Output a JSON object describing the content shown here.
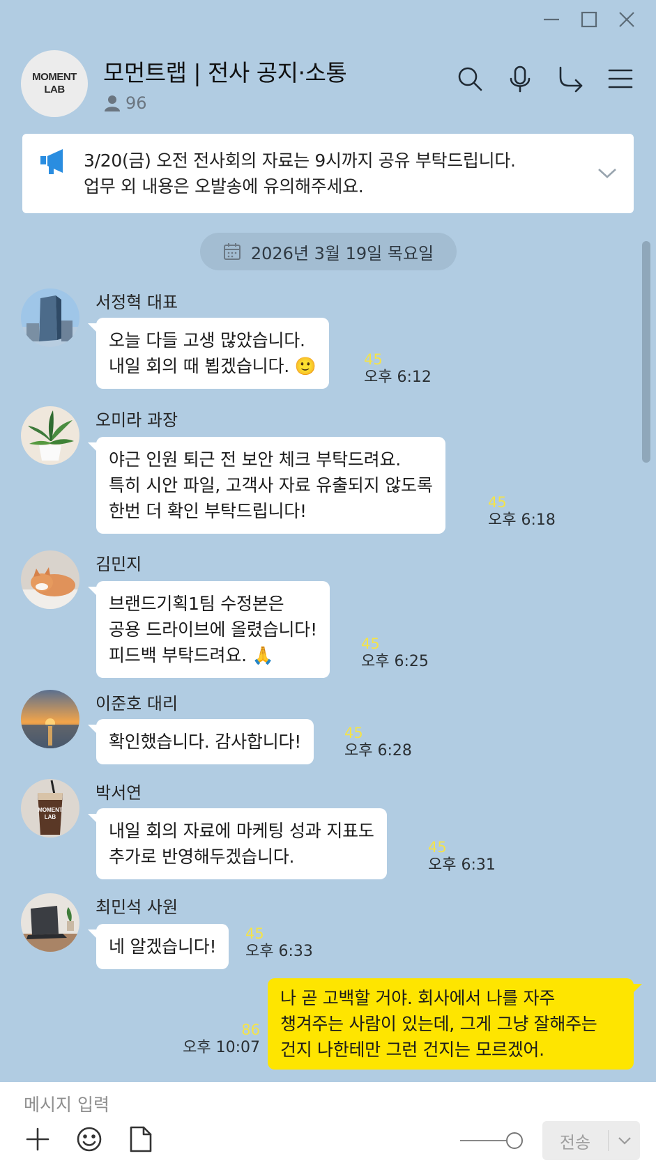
{
  "window": {
    "controls": [
      "minimize-icon",
      "maximize-icon",
      "close-icon"
    ]
  },
  "room": {
    "logo_line1": "MOMENT",
    "logo_line2": "LAB",
    "title": "모먼트랩 | 전사 공지·소통",
    "member_count": "96"
  },
  "header_actions": [
    "search-icon",
    "microphone-icon",
    "share-icon",
    "menu-icon"
  ],
  "notice": {
    "line1": "3/20(금) 오전 전사회의 자료는 9시까지 공유 부탁드립니다.",
    "line2": "업무 외 내용은 오발송에 유의해주세요."
  },
  "date_divider": "2026년 3월 19일 목요일",
  "messages": [
    {
      "sender": "서정혁 대표",
      "lines": [
        "오늘 다들 고생 많았습니다.",
        "내일 회의 때 뵙겠습니다. 🙂"
      ],
      "unread": "45",
      "time": "오후 6:12",
      "avatar": "building-avatar"
    },
    {
      "sender": "오미라 과장",
      "lines": [
        "야근 인원 퇴근 전 보안 체크 부탁드려요.",
        "특히 시안 파일, 고객사 자료 유출되지 않도록",
        "한번 더 확인 부탁드립니다!"
      ],
      "unread": "45",
      "time": "오후 6:18",
      "avatar": "plant-avatar"
    },
    {
      "sender": "김민지",
      "lines": [
        "브랜드기획1팀 수정본은",
        "공용 드라이브에 올렸습니다!",
        "피드백 부탁드려요. 🙏"
      ],
      "unread": "45",
      "time": "오후 6:25",
      "avatar": "cat-avatar"
    },
    {
      "sender": "이준호 대리",
      "lines": [
        "확인했습니다. 감사합니다!"
      ],
      "unread": "45",
      "time": "오후 6:28",
      "avatar": "sunset-avatar"
    },
    {
      "sender": "박서연",
      "lines": [
        "내일 회의 자료에 마케팅 성과 지표도",
        "추가로 반영해두겠습니다."
      ],
      "unread": "45",
      "time": "오후 6:31",
      "avatar": "coffee-avatar",
      "cup_text1": "MOMENT",
      "cup_text2": "LAB"
    },
    {
      "sender": "최민석 사원",
      "lines": [
        "네 알겠습니다!"
      ],
      "unread": "45",
      "time": "오후 6:33",
      "avatar": "laptop-avatar"
    }
  ],
  "my_message": {
    "lines": [
      "나 곧 고백할 거야. 회사에서 나를 자주",
      "챙겨주는 사람이 있는데, 그게 그냥 잘해주는",
      "건지 나한테만 그런 건지는 모르겠어."
    ],
    "unread": "86",
    "time": "오후 10:07"
  },
  "composer": {
    "placeholder": "메시지 입력",
    "value": "",
    "tools": [
      "plus-icon",
      "emoji-icon",
      "file-icon"
    ],
    "send_label": "전송"
  },
  "colors": {
    "background": "#b1cce2",
    "my_bubble": "#fee500",
    "unread": "#f4e34a",
    "notice_icon": "#2a8de0"
  }
}
